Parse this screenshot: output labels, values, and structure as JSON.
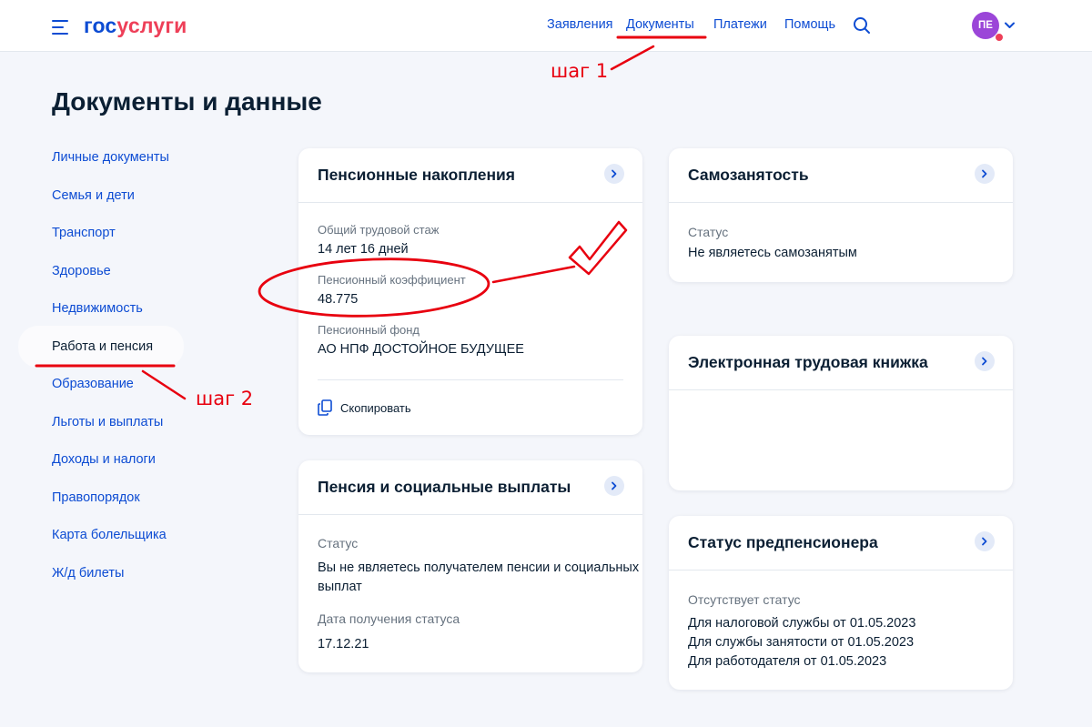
{
  "header": {
    "logo_part1": "гос",
    "logo_part2": "услуги",
    "nav": [
      "Заявления",
      "Документы",
      "Платежи",
      "Помощь"
    ],
    "avatar_initials": "ПЕ"
  },
  "page": {
    "title": "Документы и данные"
  },
  "sidebar": {
    "items": [
      "Личные документы",
      "Семья и дети",
      "Транспорт",
      "Здоровье",
      "Недвижимость",
      "Работа и пенсия",
      "Образование",
      "Льготы и выплаты",
      "Доходы и налоги",
      "Правопорядок",
      "Карта болельщика",
      "Ж/д билеты"
    ],
    "active": "Работа и пенсия"
  },
  "cards": {
    "pension_savings": {
      "title": "Пенсионные накопления",
      "experience_label": "Общий трудовой стаж",
      "experience_value": "14 лет 16 дней",
      "coefficient_label": "Пенсионный коэффициент",
      "coefficient_value": "48.775",
      "fund_label": "Пенсионный фонд",
      "fund_value": "АО НПФ ДОСТОЙНОЕ БУДУЩЕЕ",
      "copy_label": "Скопировать"
    },
    "pension_social": {
      "title": "Пенсия и социальные выплаты",
      "status_label": "Статус",
      "status_line1": "Вы не являетесь получателем пенсии и социальных",
      "status_line2": "выплат",
      "date_label": "Дата получения статуса",
      "date_value": "17.12.21"
    },
    "self_employment": {
      "title": "Самозанятость",
      "status_label": "Статус",
      "status_value": "Не являетесь самозанятым"
    },
    "work_book": {
      "title": "Электронная трудовая книжка"
    },
    "pre_pension": {
      "title": "Статус предпенсионера",
      "status_label": "Отсутствует статус",
      "lines": [
        "Для налоговой службы от 01.05.2023",
        "Для службы занятости от 01.05.2023",
        "Для работодателя от 01.05.2023"
      ]
    }
  },
  "annotations": {
    "step1": "шаг 1",
    "step2": "шаг 2"
  },
  "colors": {
    "brand_blue": "#0d4cd3",
    "brand_red": "#ee3f58",
    "annotation_red": "#e8000f",
    "avatar": "#9b46d8"
  }
}
